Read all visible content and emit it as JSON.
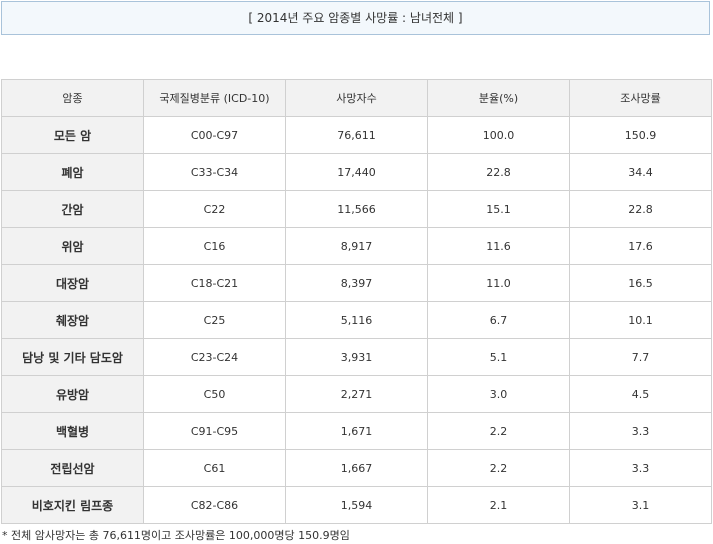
{
  "title": "[ 2014년 주요 암종별 사망률 : 남녀전체 ]",
  "headers": [
    "암종",
    "국제질병분류 (ICD-10)",
    "사망자수",
    "분율(%)",
    "조사망률"
  ],
  "rows": [
    [
      "모든 암",
      "C00-C97",
      "76,611",
      "100.0",
      "150.9"
    ],
    [
      "폐암",
      "C33-C34",
      "17,440",
      "22.8",
      "34.4"
    ],
    [
      "간암",
      "C22",
      "11,566",
      "15.1",
      "22.8"
    ],
    [
      "위암",
      "C16",
      "8,917",
      "11.6",
      "17.6"
    ],
    [
      "대장암",
      "C18-C21",
      "8,397",
      "11.0",
      "16.5"
    ],
    [
      "췌장암",
      "C25",
      "5,116",
      "6.7",
      "10.1"
    ],
    [
      "담낭 및 기타 담도암",
      "C23-C24",
      "3,931",
      "5.1",
      "7.7"
    ],
    [
      "유방암",
      "C50",
      "2,271",
      "3.0",
      "4.5"
    ],
    [
      "백혈병",
      "C91-C95",
      "1,671",
      "2.2",
      "3.3"
    ],
    [
      "전립선암",
      "C61",
      "1,667",
      "2.2",
      "3.3"
    ],
    [
      "비호지킨 림프종",
      "C82-C86",
      "1,594",
      "2.1",
      "3.1"
    ]
  ],
  "footnote": "* 전체 암사망자는 총 76,611명이고 조사망률은 100,000명당 150.9명임"
}
